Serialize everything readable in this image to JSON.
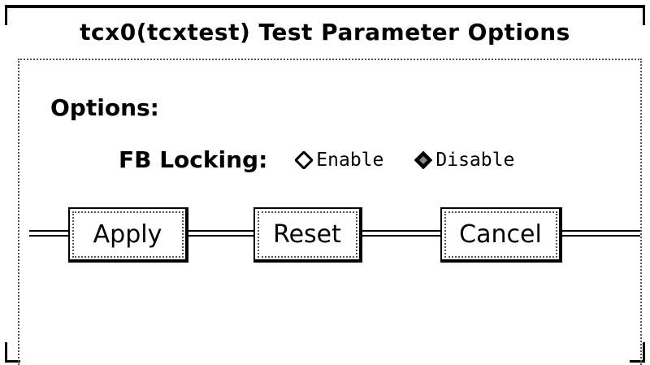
{
  "window": {
    "title": "tcx0(tcxtest) Test Parameter Options"
  },
  "options": {
    "heading": "Options:",
    "fb_locking": {
      "label": "FB Locking:",
      "choices": [
        "Enable",
        "Disable"
      ],
      "selected": "Disable"
    }
  },
  "buttons": {
    "apply": "Apply",
    "reset": "Reset",
    "cancel": "Cancel"
  },
  "icons": {
    "unselected": "diamond-outline-icon",
    "selected": "diamond-filled-icon"
  },
  "colors": {
    "background": "#ffffff",
    "foreground": "#000000"
  }
}
